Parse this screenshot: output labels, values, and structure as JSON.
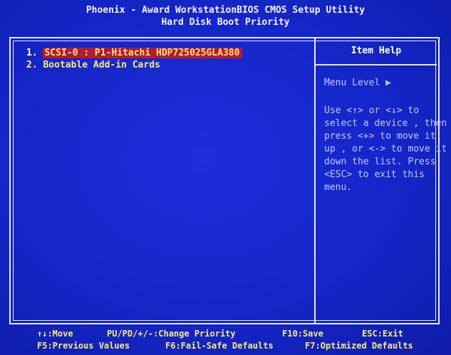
{
  "header": {
    "line1": "Phoenix - Award WorkstationBIOS CMOS Setup Utility",
    "line2": "Hard Disk Boot Priority"
  },
  "boot_list": [
    {
      "number": "1.",
      "device": "SCSI-0    :  P1-Hitachi HDP725025GLA380",
      "selected": true
    },
    {
      "number": "2.",
      "device": "Bootable Add-in Cards",
      "selected": false
    }
  ],
  "help": {
    "title": "Item Help",
    "menu_level": "Menu Level   ▶",
    "text": "Use <↑> or <↓> to\nselect a device , then\npress <+> to move it\nup , or <-> to move it\ndown the list. Press\n<ESC> to exit this\nmenu."
  },
  "footer": {
    "move": "↑↓:Move",
    "change_priority": "PU/PD/+/-:Change Priority",
    "save": "F10:Save",
    "exit": "ESC:Exit",
    "previous_values": "F5:Previous Values",
    "failsafe": "F6:Fail-Safe Defaults",
    "optimized": "F7:Optimized Defaults"
  },
  "colors": {
    "background": "#1426c8",
    "selected_bg": "#b51a2e",
    "highlight_text": "#ffe97a",
    "help_text": "#c8c8ff"
  }
}
